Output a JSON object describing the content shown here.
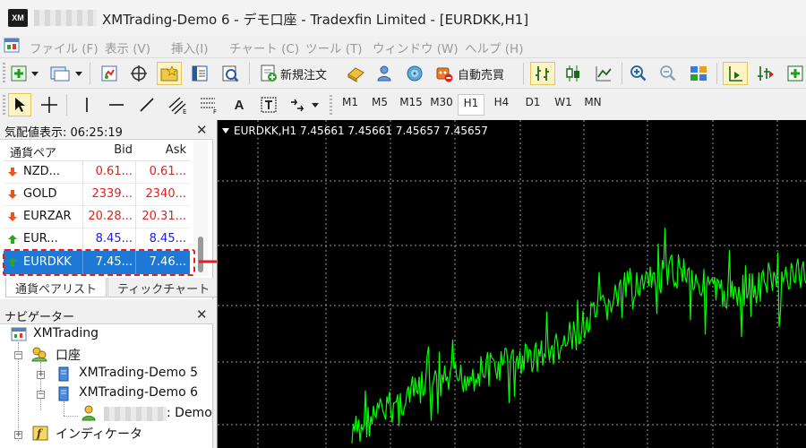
{
  "window": {
    "logo_text": "XM",
    "title": "XMTrading-Demo 6 - デモ口座 - Tradexfin Limited - [EURDKK,H1]"
  },
  "menu": {
    "items": [
      "ファイル (F)",
      "表示 (V)",
      "挿入(I)",
      "チャート (C)",
      "ツール (T)",
      "ウィンドウ (W)",
      "ヘルプ (H)"
    ]
  },
  "toolbar": {
    "new_order_label": "新規注文",
    "auto_trading_label": "自動売買",
    "text_tool_label": "A",
    "timeframes": [
      "M1",
      "M5",
      "M15",
      "M30",
      "H1",
      "H4",
      "D1",
      "W1",
      "MN"
    ],
    "active_timeframe": "H1"
  },
  "market_watch": {
    "title": "気配値表示: 06:25:19",
    "columns": [
      "通貨ペア",
      "Bid",
      "Ask"
    ],
    "rows": [
      {
        "symbol": "NZD...",
        "bid": "0.61...",
        "ask": "0.61...",
        "direction": "down",
        "color": "red"
      },
      {
        "symbol": "GOLD",
        "bid": "2339...",
        "ask": "2340...",
        "direction": "down",
        "color": "red"
      },
      {
        "symbol": "EURZAR",
        "bid": "20.28...",
        "ask": "20.31...",
        "direction": "down",
        "color": "red"
      },
      {
        "symbol": "EUR...",
        "bid": "8.45...",
        "ask": "8.45...",
        "direction": "up",
        "color": "blue"
      },
      {
        "symbol": "EURDKK",
        "bid": "7.45...",
        "ask": "7.46...",
        "direction": "up",
        "color": "white",
        "selected": true
      }
    ],
    "tabs": [
      "通貨ペアリスト",
      "ティックチャート"
    ],
    "active_tab": 0
  },
  "navigator": {
    "title": "ナビゲーター",
    "root": "XMTrading",
    "accounts_label": "口座",
    "accounts": [
      "XMTrading-Demo 5",
      "XMTrading-Demo 6"
    ],
    "account_user_suffix": ": Demo",
    "indicators_label": "インディケータ"
  },
  "chart": {
    "header": "EURDKK,H1  7.45661 7.45661 7.45657 7.45657",
    "background": "#000000",
    "line_color": "#00ff00",
    "grid_color": "#9a9a9a",
    "grid": true
  },
  "colors": {
    "bid_down": "#e02020",
    "bid_up": "#2020d8",
    "selection": "#1e78d6",
    "annotation": "#e02020"
  }
}
